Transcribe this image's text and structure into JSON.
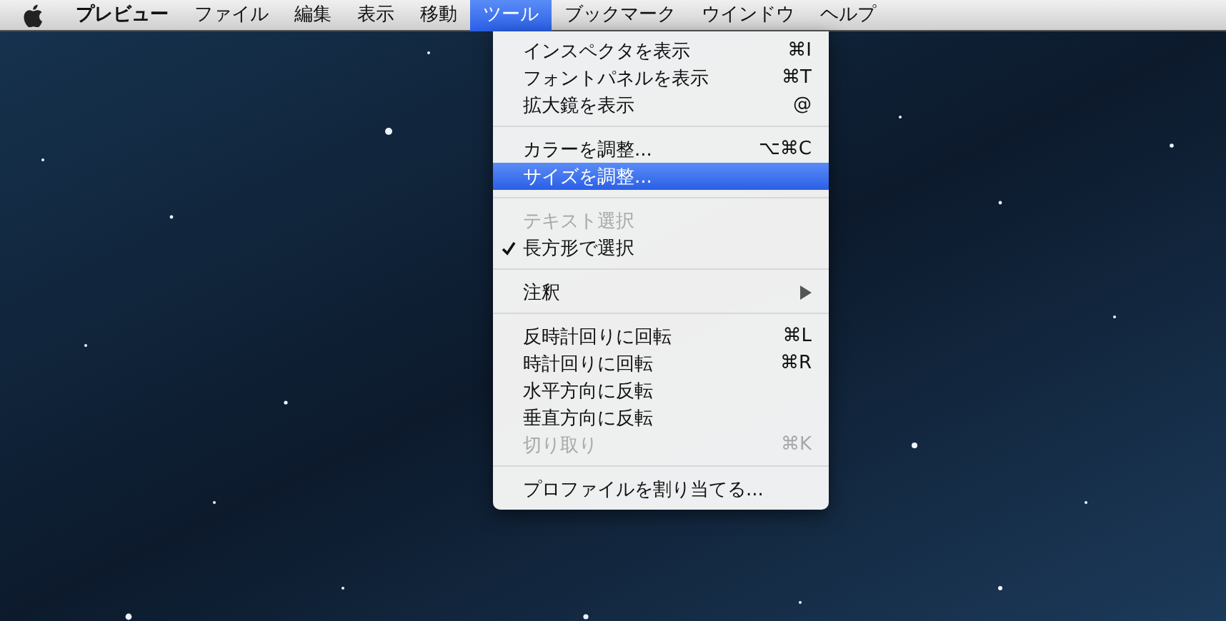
{
  "menubar": [
    {
      "label": "プレビュー",
      "selected": false,
      "bold": true
    },
    {
      "label": "ファイル",
      "selected": false,
      "bold": false
    },
    {
      "label": "編集",
      "selected": false,
      "bold": false
    },
    {
      "label": "表示",
      "selected": false,
      "bold": false
    },
    {
      "label": "移動",
      "selected": false,
      "bold": false
    },
    {
      "label": "ツール",
      "selected": true,
      "bold": false
    },
    {
      "label": "ブックマーク",
      "selected": false,
      "bold": false
    },
    {
      "label": "ウインドウ",
      "selected": false,
      "bold": false
    },
    {
      "label": "ヘルプ",
      "selected": false,
      "bold": false
    }
  ],
  "menu": {
    "items": [
      {
        "kind": "item",
        "label": "インスペクタを表示",
        "shortcut": "⌘I",
        "disabled": false,
        "checked": false,
        "selected": false
      },
      {
        "kind": "item",
        "label": "フォントパネルを表示",
        "shortcut": "⌘T",
        "disabled": false,
        "checked": false,
        "selected": false
      },
      {
        "kind": "item",
        "label": "拡大鏡を表示",
        "shortcut": "@",
        "disabled": false,
        "checked": false,
        "selected": false
      },
      {
        "kind": "separator"
      },
      {
        "kind": "item",
        "label": "カラーを調整...",
        "shortcut": "⌥⌘C",
        "disabled": false,
        "checked": false,
        "selected": false
      },
      {
        "kind": "item",
        "label": "サイズを調整...",
        "disabled": false,
        "checked": false,
        "selected": true
      },
      {
        "kind": "separator"
      },
      {
        "kind": "item",
        "label": "テキスト選択",
        "disabled": true,
        "checked": false,
        "selected": false
      },
      {
        "kind": "item",
        "label": "長方形で選択",
        "disabled": false,
        "checked": true,
        "selected": false
      },
      {
        "kind": "separator"
      },
      {
        "kind": "submenu",
        "label": "注釈",
        "disabled": false,
        "checked": false,
        "selected": false
      },
      {
        "kind": "separator"
      },
      {
        "kind": "item",
        "label": "反時計回りに回転",
        "shortcut": "⌘L",
        "disabled": false,
        "checked": false,
        "selected": false
      },
      {
        "kind": "item",
        "label": "時計回りに回転",
        "shortcut": "⌘R",
        "disabled": false,
        "checked": false,
        "selected": false
      },
      {
        "kind": "item",
        "label": "水平方向に反転",
        "disabled": false,
        "checked": false,
        "selected": false
      },
      {
        "kind": "item",
        "label": "垂直方向に反転",
        "disabled": false,
        "checked": false,
        "selected": false
      },
      {
        "kind": "item",
        "label": "切り取り",
        "shortcut": "⌘K",
        "disabled": true,
        "checked": false,
        "selected": false
      },
      {
        "kind": "separator"
      },
      {
        "kind": "item",
        "label": "プロファイルを割り当てる...",
        "disabled": false,
        "checked": false,
        "selected": false
      }
    ]
  }
}
